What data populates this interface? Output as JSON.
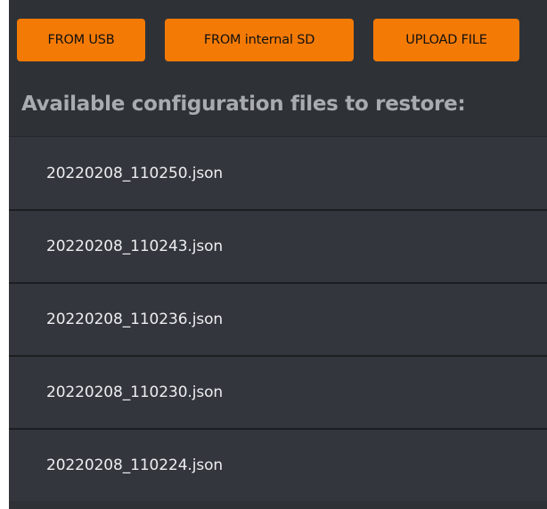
{
  "toolbar": {
    "buttons": [
      {
        "label": "FROM USB"
      },
      {
        "label": "FROM internal SD"
      },
      {
        "label": "UPLOAD FILE"
      }
    ]
  },
  "restore": {
    "heading": "Available configuration files to restore:",
    "files": [
      {
        "name": "20220208_110250.json"
      },
      {
        "name": "20220208_110243.json"
      },
      {
        "name": "20220208_110236.json"
      },
      {
        "name": "20220208_110230.json"
      },
      {
        "name": "20220208_110224.json"
      }
    ]
  },
  "colors": {
    "accent": "#f47a06",
    "panel_background": "#2e3237",
    "row_background": "#33363c",
    "heading_text": "#a8abb0"
  }
}
